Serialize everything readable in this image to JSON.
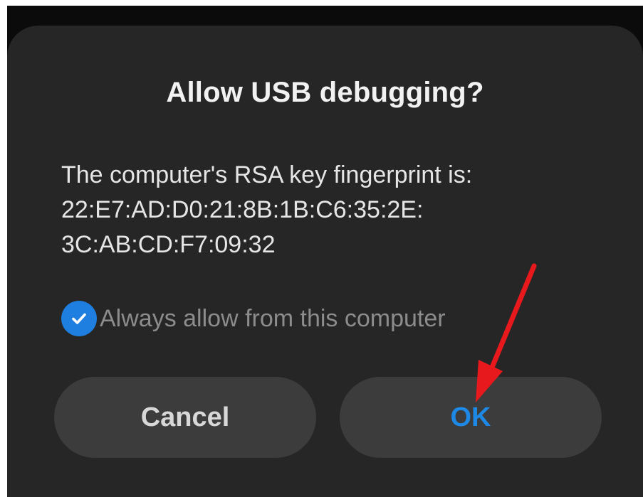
{
  "dialog": {
    "title": "Allow USB debugging?",
    "message_lines": [
      "The computer's RSA key fingerprint is:",
      "22:E7:AD:D0:21:8B:1B:C6:35:2E:",
      "3C:AB:CD:F7:09:32"
    ],
    "always_allow": {
      "label": "Always allow from this computer",
      "checked": true
    },
    "buttons": {
      "cancel": "Cancel",
      "ok": "OK"
    }
  },
  "colors": {
    "dialog_background": "#262626",
    "button_background": "#3c3c3c",
    "accent": "#1e88e5",
    "checkbox": "#1e7fe0",
    "annotation_arrow": "#e8191c"
  },
  "icons": {
    "checkbox": "checkmark-icon",
    "annotation": "red-arrow-icon"
  }
}
